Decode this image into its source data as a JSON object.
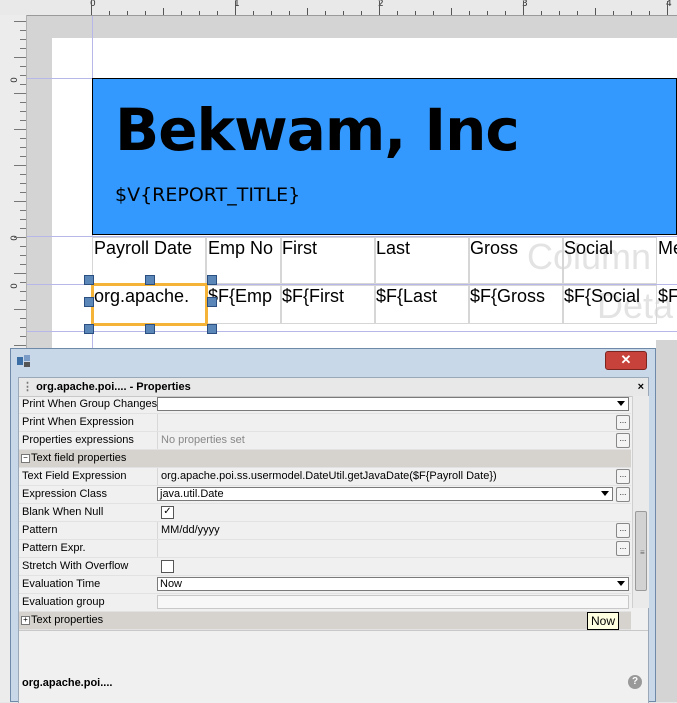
{
  "ruler": {
    "numbers": [
      "0",
      "1",
      "2",
      "3",
      "4"
    ]
  },
  "report": {
    "company": "Bekwam, Inc",
    "title_expr": "$V{REPORT_TITLE}",
    "column_headers": [
      "Payroll Date",
      "Emp No",
      "First",
      "Last",
      "Gross",
      "Social",
      "Me"
    ],
    "detail_fields": [
      "org.apache.",
      "$F{Emp",
      "$F{First",
      "$F{Last",
      "$F{Gross",
      "$F{Social",
      "$F"
    ],
    "watermark_column": "Column",
    "watermark_detail": "Deta"
  },
  "properties_window": {
    "close_glyph": "✕",
    "panel_title": "org.apache.poi.... - Properties",
    "panel_close": "×",
    "rows": {
      "print_when_group_changes": {
        "label": "Print When Group Changes",
        "value": ""
      },
      "print_when_expression": {
        "label": "Print When Expression",
        "value": ""
      },
      "properties_expressions": {
        "label": "Properties expressions",
        "value": "No properties set"
      },
      "text_field_properties": {
        "label": "Text field properties",
        "expander": "−"
      },
      "text_field_expression": {
        "label": "Text Field Expression",
        "value": "org.apache.poi.ss.usermodel.DateUtil.getJavaDate($F{Payroll Date})"
      },
      "expression_class": {
        "label": "Expression Class",
        "value": "java.util.Date"
      },
      "blank_when_null": {
        "label": "Blank When Null",
        "checked": true,
        "mark": "✓"
      },
      "pattern": {
        "label": "Pattern",
        "value": "MM/dd/yyyy"
      },
      "pattern_expr": {
        "label": "Pattern Expr.",
        "value": ""
      },
      "stretch_with_overflow": {
        "label": "Stretch With Overflow",
        "checked": false,
        "mark": ""
      },
      "evaluation_time": {
        "label": "Evaluation Time",
        "value": "Now"
      },
      "evaluation_group": {
        "label": "Evaluation group",
        "value": ""
      },
      "text_properties": {
        "label": "Text properties",
        "expander": "+"
      }
    },
    "ellipsis": "...",
    "tooltip": "Now",
    "description_title": "org.apache.poi....",
    "help_glyph": "?"
  },
  "colors": {
    "title_band": "#3399ff",
    "selection": "#f5b437",
    "handle": "#5b86b8"
  }
}
